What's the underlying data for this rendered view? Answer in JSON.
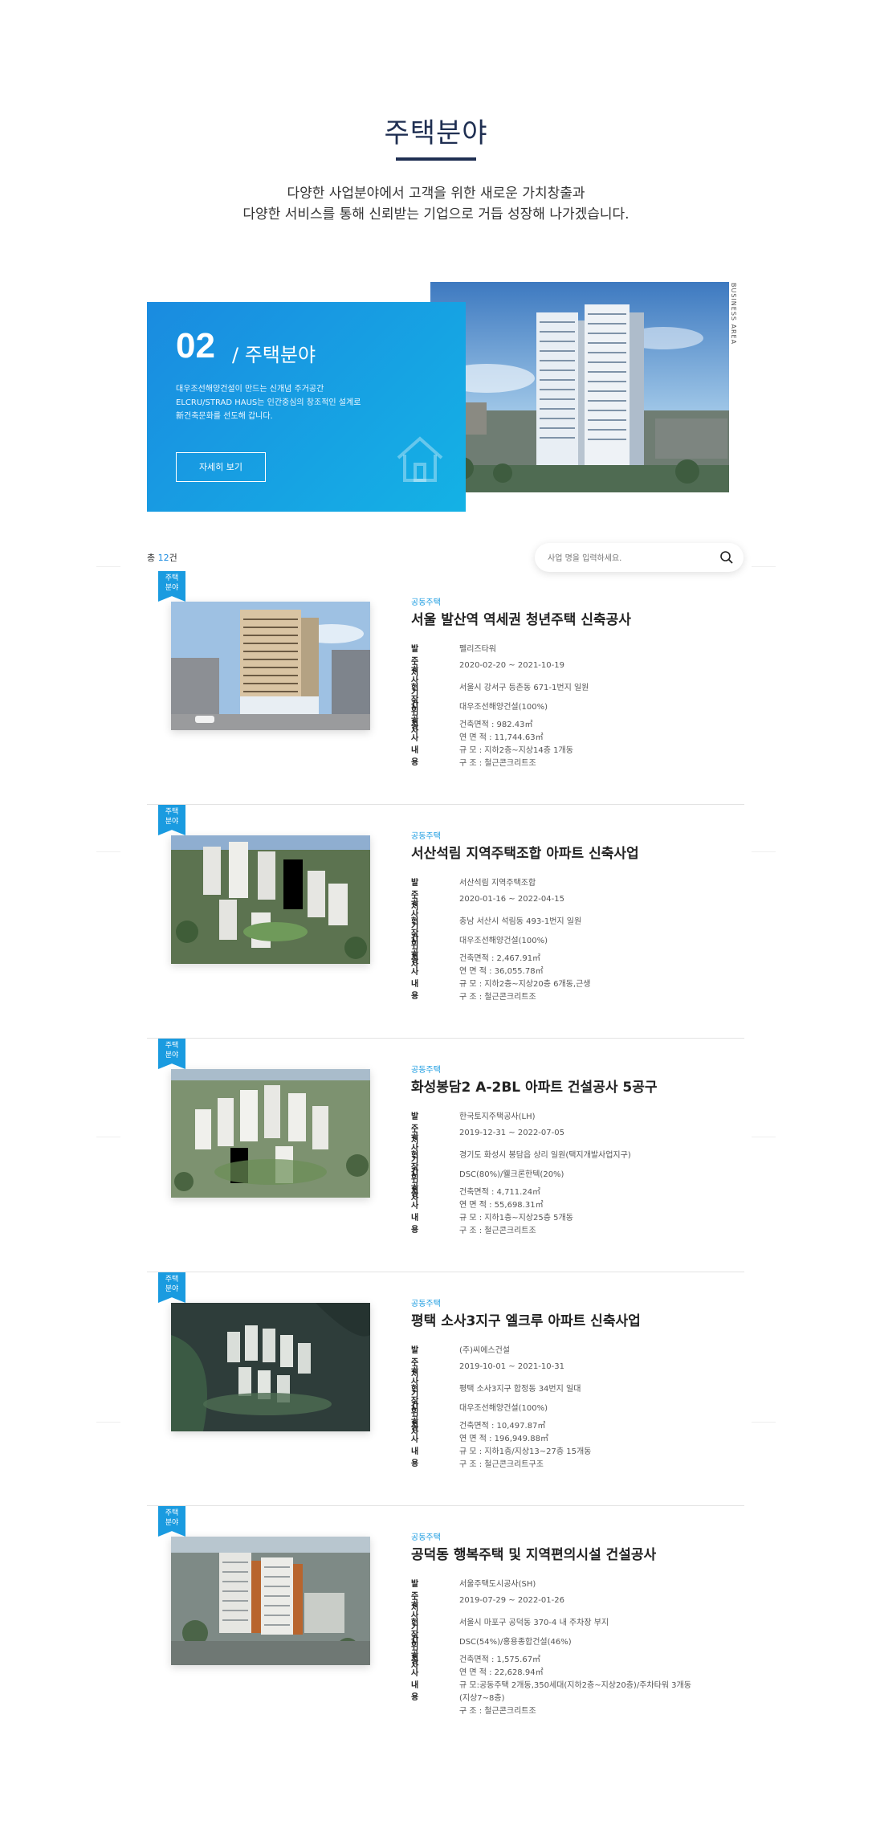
{
  "header": {
    "title": "주택분야",
    "subtitle_line1": "다양한 사업분야에서 고객을 위한 새로운 가치창출과",
    "subtitle_line2": "다양한 서비스를 통해 신뢰받는 기업으로 거듭 성장해 나가겠습니다."
  },
  "hero": {
    "side_label": "BUSINESS AREA",
    "number": "02",
    "category": "/ 주택분야",
    "desc_line1": "대우조선해양건설이 만드는 신개념 주거공간",
    "desc_line2": "ELCRU/STRAD HAUS는 인간중심의 창조적인 설계로",
    "desc_line3": "新건축문화를 선도해 갑니다.",
    "button": "자세히 보기"
  },
  "list": {
    "count_prefix": "총 ",
    "count_num": "12",
    "count_suffix": "건",
    "search_placeholder": "사업 명을 입력하세요."
  },
  "labels": {
    "owner": "발주처",
    "period": "공사 기간",
    "site": "현장위치",
    "contractor": "시공사",
    "content": "공사내용"
  },
  "colors": {
    "accent": "#1a9be0",
    "navy": "#1f2f52"
  },
  "projects": [
    {
      "badge1": "주택",
      "badge2": "분야",
      "kicker": "공동주택",
      "title": "서울 발산역 역세권 청년주택 신축공사",
      "owner": "펠리즈타워",
      "period": "2020-02-20 ~ 2021-10-19",
      "site": "서울시 강서구 등촌동 671-1번지 일원",
      "contractor": "대우조선해양건설(100%)",
      "specs": [
        "건축면적 : 982.43㎡",
        "연 면 적 : 11,744.63㎡",
        "규 모 : 지하2층~지상14층 1개동",
        "구 조 : 철근콘크리트조"
      ]
    },
    {
      "badge1": "주택",
      "badge2": "분야",
      "kicker": "공동주택",
      "title": "서산석림 지역주택조합 아파트 신축사업",
      "owner": "서산석림 지역주택조합",
      "period": "2020-01-16 ~ 2022-04-15",
      "site": "충남 서산시 석림동 493-1번지 일원",
      "contractor": "대우조선해양건설(100%)",
      "specs": [
        "건축면적 : 2,467.91㎡",
        "연 면 적 : 36,055.78㎡",
        "규 모 : 지하2층~지상20층 6개동,근생",
        "구 조 : 철근콘크리트조"
      ]
    },
    {
      "badge1": "주택",
      "badge2": "분야",
      "kicker": "공동주택",
      "title": "화성봉담2 A-2BL 아파트 건설공사 5공구",
      "owner": "한국토지주택공사(LH)",
      "period": "2019-12-31 ~ 2022-07-05",
      "site": "경기도 화성시 봉담읍 상리 일원(택지개발사업지구)",
      "contractor": "DSC(80%)/웰크론한텍(20%)",
      "specs": [
        "건축면적 : 4,711.24㎡",
        "연 면 적 : 55,698.31㎡",
        "규 모 : 지하1층~지상25층 5개동",
        "구 조 : 철근콘크리트조"
      ]
    },
    {
      "badge1": "주택",
      "badge2": "분야",
      "kicker": "공동주택",
      "title": "평택 소사3지구 엘크루 아파트 신축사업",
      "owner": "(주)씨에스건설",
      "period": "2019-10-01 ~ 2021-10-31",
      "site": "평택 소사3지구 합정동 34번지 일대",
      "contractor": "대우조선해양건설(100%)",
      "specs": [
        "건축면적 : 10,497.87㎡",
        "연 면 적 : 196,949.88㎡",
        "규 모 : 지하1층/지상13~27층 15개동",
        "구 조 : 철근콘크리트구조"
      ]
    },
    {
      "badge1": "주택",
      "badge2": "분야",
      "kicker": "공동주택",
      "title": "공덕동 행복주택 및 지역편의시설 건설공사",
      "owner": "서울주택도시공사(SH)",
      "period": "2019-07-29 ~ 2022-01-26",
      "site": "서울시 마포구 공덕동 370-4 내 주차장 부지",
      "contractor": "DSC(54%)/홍용종합건설(46%)",
      "specs": [
        "건축면적 : 1,575.67㎡",
        "연 면 적 : 22,628.94㎡",
        "규 모:공동주택 2개동,350세대(지하2층~지상20층)/주차타워 3개동",
        "(지상7~8층)",
        "구 조 : 철근콘크리트조"
      ]
    }
  ]
}
